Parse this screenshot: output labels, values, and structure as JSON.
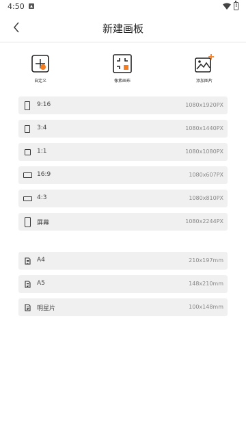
{
  "status_bar": {
    "time": "4:50",
    "icons": [
      "notification-icon",
      "wifi-icon",
      "battery-icon"
    ],
    "battery_mark": "!"
  },
  "header": {
    "title": "新建画板",
    "back_icon": "chevron-left-icon"
  },
  "tools": [
    {
      "label": "自定义",
      "icon": "custom-canvas-icon"
    },
    {
      "label": "像素画布",
      "icon": "pixel-canvas-icon"
    },
    {
      "label": "添加图片",
      "icon": "add-image-icon"
    }
  ],
  "canvas_sizes": [
    {
      "label": "9:16",
      "size": "1080x1920PX",
      "icon": "portrait-tall-icon"
    },
    {
      "label": "3:4",
      "size": "1080x1440PX",
      "icon": "portrait-icon"
    },
    {
      "label": "1:1",
      "size": "1080x1080PX",
      "icon": "square-icon"
    },
    {
      "label": "16:9",
      "size": "1080x607PX",
      "icon": "landscape-wide-icon"
    },
    {
      "label": "4:3",
      "size": "1080x810PX",
      "icon": "landscape-icon"
    },
    {
      "label": "屏幕",
      "size": "1080x2244PX",
      "icon": "screen-icon"
    }
  ],
  "paper_sizes": [
    {
      "label": "A4",
      "size": "210x197mm",
      "icon": "document-icon"
    },
    {
      "label": "A5",
      "size": "148x210mm",
      "icon": "document-icon"
    },
    {
      "label": "明星片",
      "size": "100x148mm",
      "icon": "document-icon"
    }
  ],
  "colors": {
    "accent": "#f57c1f",
    "row_background": "#f0f0f0",
    "text_primary": "#222222",
    "text_secondary": "#888888"
  }
}
